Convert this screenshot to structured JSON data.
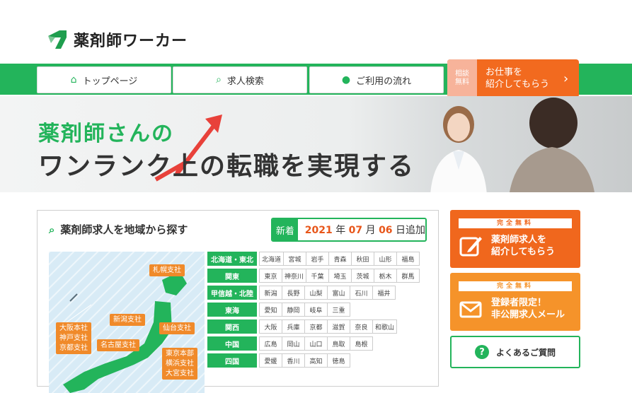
{
  "header": {
    "logo_text": "薬剤師ワーカー"
  },
  "nav": {
    "items": [
      {
        "label": "トップページ",
        "icon": "home-icon"
      },
      {
        "label": "求人検索",
        "icon": "search-icon"
      },
      {
        "label": "ご利用の流れ",
        "icon": "person-icon"
      }
    ],
    "cta": {
      "badge_line1": "相談",
      "badge_line2": "無料",
      "line1": "お仕事を",
      "line2": "紹介してもらう"
    }
  },
  "hero": {
    "line1": "薬剤師さんの",
    "line2": "ワンランク上の転職を実現する"
  },
  "search_panel": {
    "title": "薬剤師求人を地域から探す",
    "news_label": "新着",
    "news_year": "2021",
    "news_year_unit": "年",
    "news_month": "07",
    "news_month_unit": "月",
    "news_day": "06",
    "news_suffix": "日追加",
    "branches": [
      "札幌支社",
      "仙台支社",
      "新潟支社",
      "名古屋支社",
      "大阪本社",
      "神戸支社",
      "京都支社",
      "東京本部",
      "横浜支社",
      "大宮支社"
    ],
    "regions": [
      {
        "name": "北海道・東北",
        "prefs": [
          "北海道",
          "宮城",
          "岩手",
          "青森",
          "秋田",
          "山形",
          "福島"
        ]
      },
      {
        "name": "関東",
        "prefs": [
          "東京",
          "神奈川",
          "千葉",
          "埼玉",
          "茨城",
          "栃木",
          "群馬"
        ]
      },
      {
        "name": "甲信越・北陸",
        "prefs": [
          "新潟",
          "長野",
          "山梨",
          "富山",
          "石川",
          "福井"
        ]
      },
      {
        "name": "東海",
        "prefs": [
          "愛知",
          "静岡",
          "岐阜",
          "三重"
        ]
      },
      {
        "name": "関西",
        "prefs": [
          "大阪",
          "兵庫",
          "京都",
          "滋賀",
          "奈良",
          "和歌山"
        ]
      },
      {
        "name": "中国",
        "prefs": [
          "広島",
          "岡山",
          "山口",
          "鳥取",
          "島根"
        ]
      },
      {
        "name": "四国",
        "prefs": [
          "愛媛",
          "香川",
          "高知",
          "徳島"
        ]
      }
    ]
  },
  "side": {
    "card1": {
      "tag": "完全無料",
      "line1": "薬剤師求人を",
      "line2": "紹介してもらう"
    },
    "card2": {
      "tag": "完全無料",
      "line1": "登録者限定！",
      "line2": "非公開求人メール"
    },
    "faq": {
      "label": "よくあるご質問"
    }
  },
  "colors": {
    "green": "#23b45b",
    "orange": "#f0671d",
    "light_orange": "#f5932a"
  }
}
